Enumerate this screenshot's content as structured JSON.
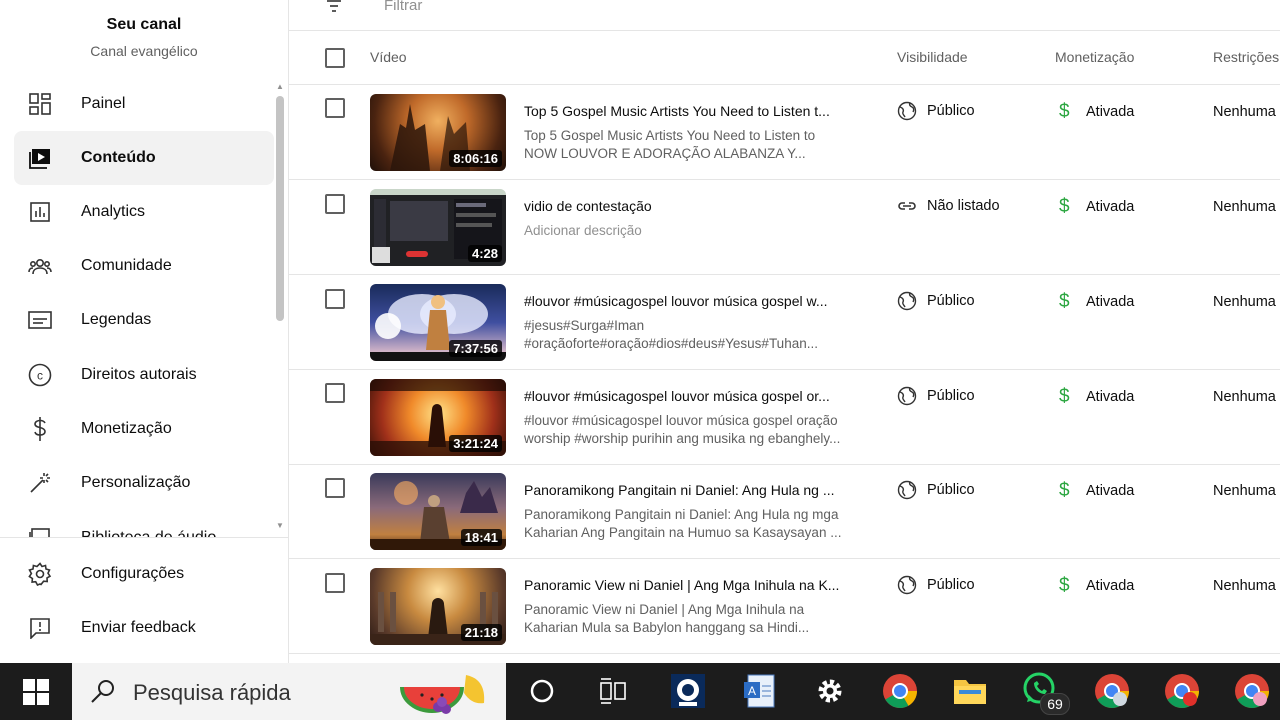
{
  "sidebar": {
    "channel_title": "Seu canal",
    "channel_subtitle": "Canal evangélico",
    "items": [
      {
        "label": "Painel",
        "icon": "dashboard-icon"
      },
      {
        "label": "Conteúdo",
        "icon": "content-icon",
        "active": true
      },
      {
        "label": "Analytics",
        "icon": "analytics-icon"
      },
      {
        "label": "Comunidade",
        "icon": "community-icon"
      },
      {
        "label": "Legendas",
        "icon": "subtitles-icon"
      },
      {
        "label": "Direitos autorais",
        "icon": "copyright-icon"
      },
      {
        "label": "Monetização",
        "icon": "dollar-icon"
      },
      {
        "label": "Personalização",
        "icon": "magic-wand-icon"
      },
      {
        "label": "Biblioteca de áudio",
        "icon": "audio-library-icon"
      }
    ],
    "bottom_items": [
      {
        "label": "Configurações",
        "icon": "settings-icon"
      },
      {
        "label": "Enviar feedback",
        "icon": "feedback-icon"
      }
    ]
  },
  "filter": {
    "placeholder": "Filtrar"
  },
  "table": {
    "headers": {
      "video": "Vídeo",
      "visibility": "Visibilidade",
      "monetization": "Monetização",
      "restrictions": "Restrições"
    },
    "rows": [
      {
        "title": "Top 5 Gospel Music Artists You Need to Listen t...",
        "desc1": "Top 5 Gospel Music Artists You Need to Listen to",
        "desc2": "NOW LOUVOR E ADORAÇÃO ALABANZA Y...",
        "duration": "8:06:16",
        "visibility": "Público",
        "vis_icon": "globe-icon",
        "monetization": "Ativada",
        "restrictions": "Nenhuma"
      },
      {
        "title": "vidio de contestação",
        "desc1": "Adicionar descrição",
        "desc2": "",
        "duration": "4:28",
        "visibility": "Não listado",
        "vis_icon": "link-icon",
        "monetization": "Ativada",
        "restrictions": "Nenhuma"
      },
      {
        "title": "#louvor #músicagospel louvor música gospel w...",
        "desc1": "#jesus#Surga#Iman",
        "desc2": "#oraçãoforte#oração#dios#deus#Yesus#Tuhan...",
        "duration": "7:37:56",
        "visibility": "Público",
        "vis_icon": "globe-icon",
        "monetization": "Ativada",
        "restrictions": "Nenhuma"
      },
      {
        "title": "#louvor #músicagospel louvor música gospel or...",
        "desc1": "#louvor #músicagospel louvor música gospel oração",
        "desc2": "worship #worship purihin ang musika ng ebanghely...",
        "duration": "3:21:24",
        "visibility": "Público",
        "vis_icon": "globe-icon",
        "monetization": "Ativada",
        "restrictions": "Nenhuma"
      },
      {
        "title": "Panoramikong Pangitain ni Daniel: Ang Hula ng ...",
        "desc1": "Panoramikong Pangitain ni Daniel: Ang Hula ng mga",
        "desc2": "Kaharian Ang Pangitain na Humuo sa Kasaysayan ...",
        "duration": "18:41",
        "visibility": "Público",
        "vis_icon": "globe-icon",
        "monetization": "Ativada",
        "restrictions": "Nenhuma"
      },
      {
        "title": "Panoramic View ni Daniel | Ang Mga Inihula na K...",
        "desc1": "Panoramic View ni Daniel | Ang Mga Inihula na",
        "desc2": "Kaharian Mula sa Babylon hanggang sa Hindi...",
        "duration": "21:18",
        "visibility": "Público",
        "vis_icon": "globe-icon",
        "monetization": "Ativada",
        "restrictions": "Nenhuma"
      }
    ]
  },
  "taskbar": {
    "search_text": "Pesquisa rápida",
    "whatsapp_badge": "69",
    "icons": [
      "windows-start-icon",
      "search-icon",
      "fruit-icon",
      "cortana-icon",
      "task-view-icon",
      "webcam-app-icon",
      "document-app-icon",
      "settings-gear-icon",
      "chrome-icon",
      "file-explorer-icon",
      "whatsapp-icon",
      "chrome-profile-icon",
      "chrome-icon-2",
      "chrome-profile-icon-2"
    ]
  },
  "colors": {
    "accent_green": "#2ba640",
    "active_bg": "#f2f2f2",
    "taskbar_bg": "#1c1c1c"
  }
}
